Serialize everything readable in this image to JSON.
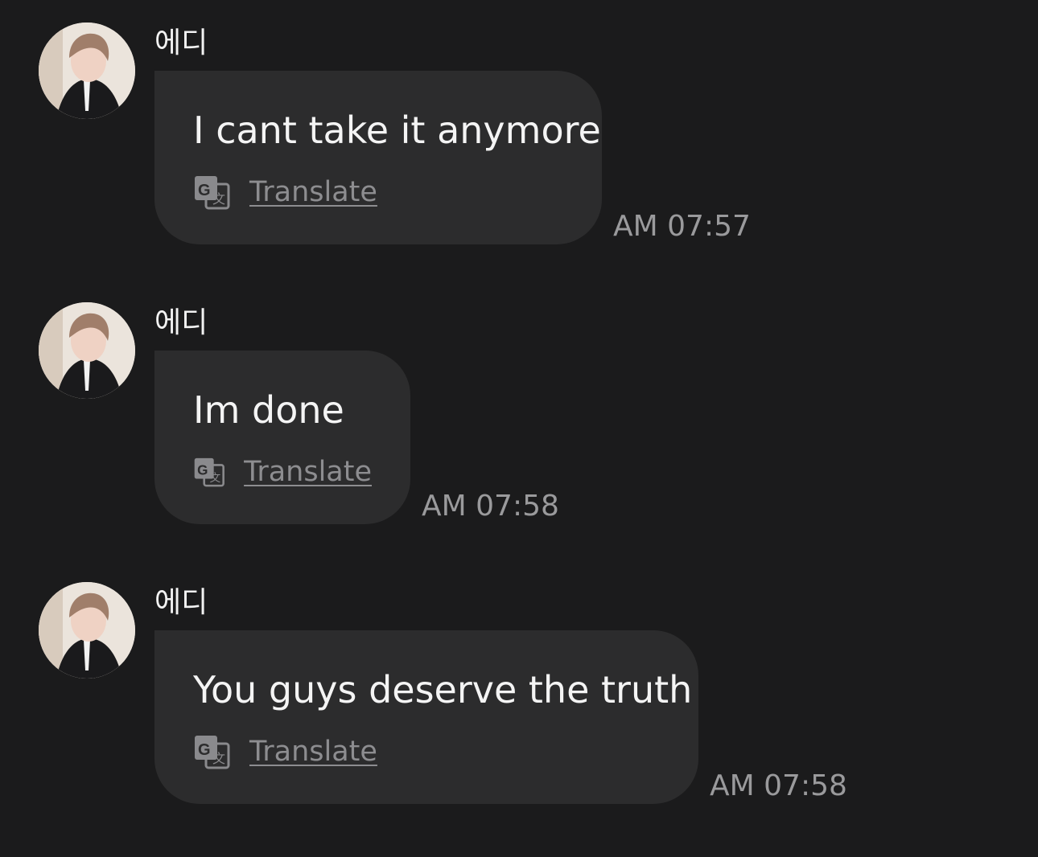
{
  "messages": [
    {
      "sender": "에디",
      "text": "I cant take it anymore",
      "translate_label": "Translate",
      "time": "AM 07:57"
    },
    {
      "sender": "에디",
      "text": "Im done",
      "translate_label": "Translate",
      "time": "AM 07:58"
    },
    {
      "sender": "에디",
      "text": "You guys deserve the truth",
      "translate_label": "Translate",
      "time": "AM 07:58"
    }
  ],
  "icons": {
    "avatar": "profile-photo",
    "translate": "google-translate-icon"
  },
  "colors": {
    "background": "#1b1b1c",
    "bubble": "#2c2c2d",
    "text": "#f4f4f4",
    "muted": "#9a9a9c"
  }
}
